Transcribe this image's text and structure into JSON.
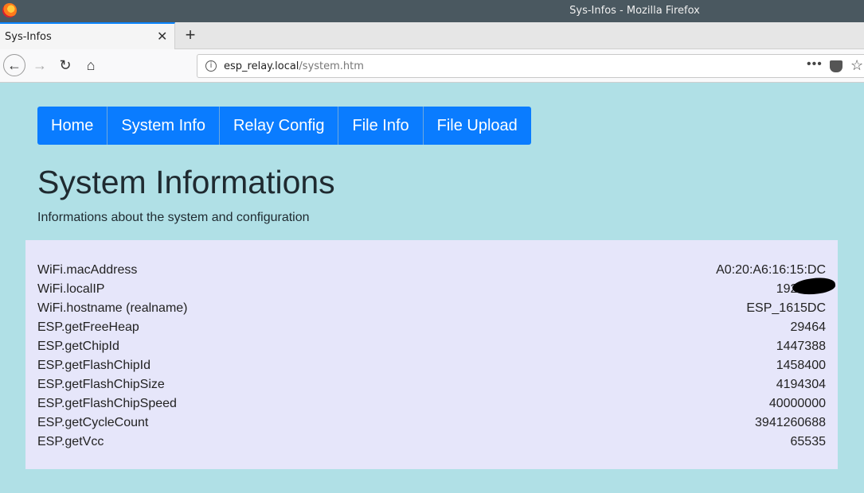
{
  "window": {
    "title": "Sys-Infos - Mozilla Firefox"
  },
  "tabs": [
    {
      "label": "Sys-Infos",
      "close_icon": "close-icon"
    }
  ],
  "toolbar": {
    "new_tab_label": "+",
    "url_host": "esp_relay.local",
    "url_path": "/system.htm"
  },
  "menu": {
    "items": [
      {
        "label": "Home"
      },
      {
        "label": "System Info"
      },
      {
        "label": "Relay Config"
      },
      {
        "label": "File Info"
      },
      {
        "label": "File Upload"
      }
    ]
  },
  "page": {
    "title": "System Informations",
    "subtitle": "Informations about the system and configuration"
  },
  "info": {
    "rows": [
      {
        "key": "WiFi.macAddress",
        "value": "A0:20:A6:16:15:DC"
      },
      {
        "key": "WiFi.localIP",
        "value": "192.168."
      },
      {
        "key": "WiFi.hostname (realname)",
        "value": "ESP_1615DC"
      },
      {
        "key": "ESP.getFreeHeap",
        "value": "29464"
      },
      {
        "key": "ESP.getChipId",
        "value": "1447388"
      },
      {
        "key": "ESP.getFlashChipId",
        "value": "1458400"
      },
      {
        "key": "ESP.getFlashChipSize",
        "value": "4194304"
      },
      {
        "key": "ESP.getFlashChipSpeed",
        "value": "40000000"
      },
      {
        "key": "ESP.getCycleCount",
        "value": "3941260688"
      },
      {
        "key": "ESP.getVcc",
        "value": "65535"
      }
    ]
  },
  "colors": {
    "page_background": "#b0e0e6",
    "menu_accent": "#0a7cff",
    "panel_background": "#e6e6fa"
  }
}
